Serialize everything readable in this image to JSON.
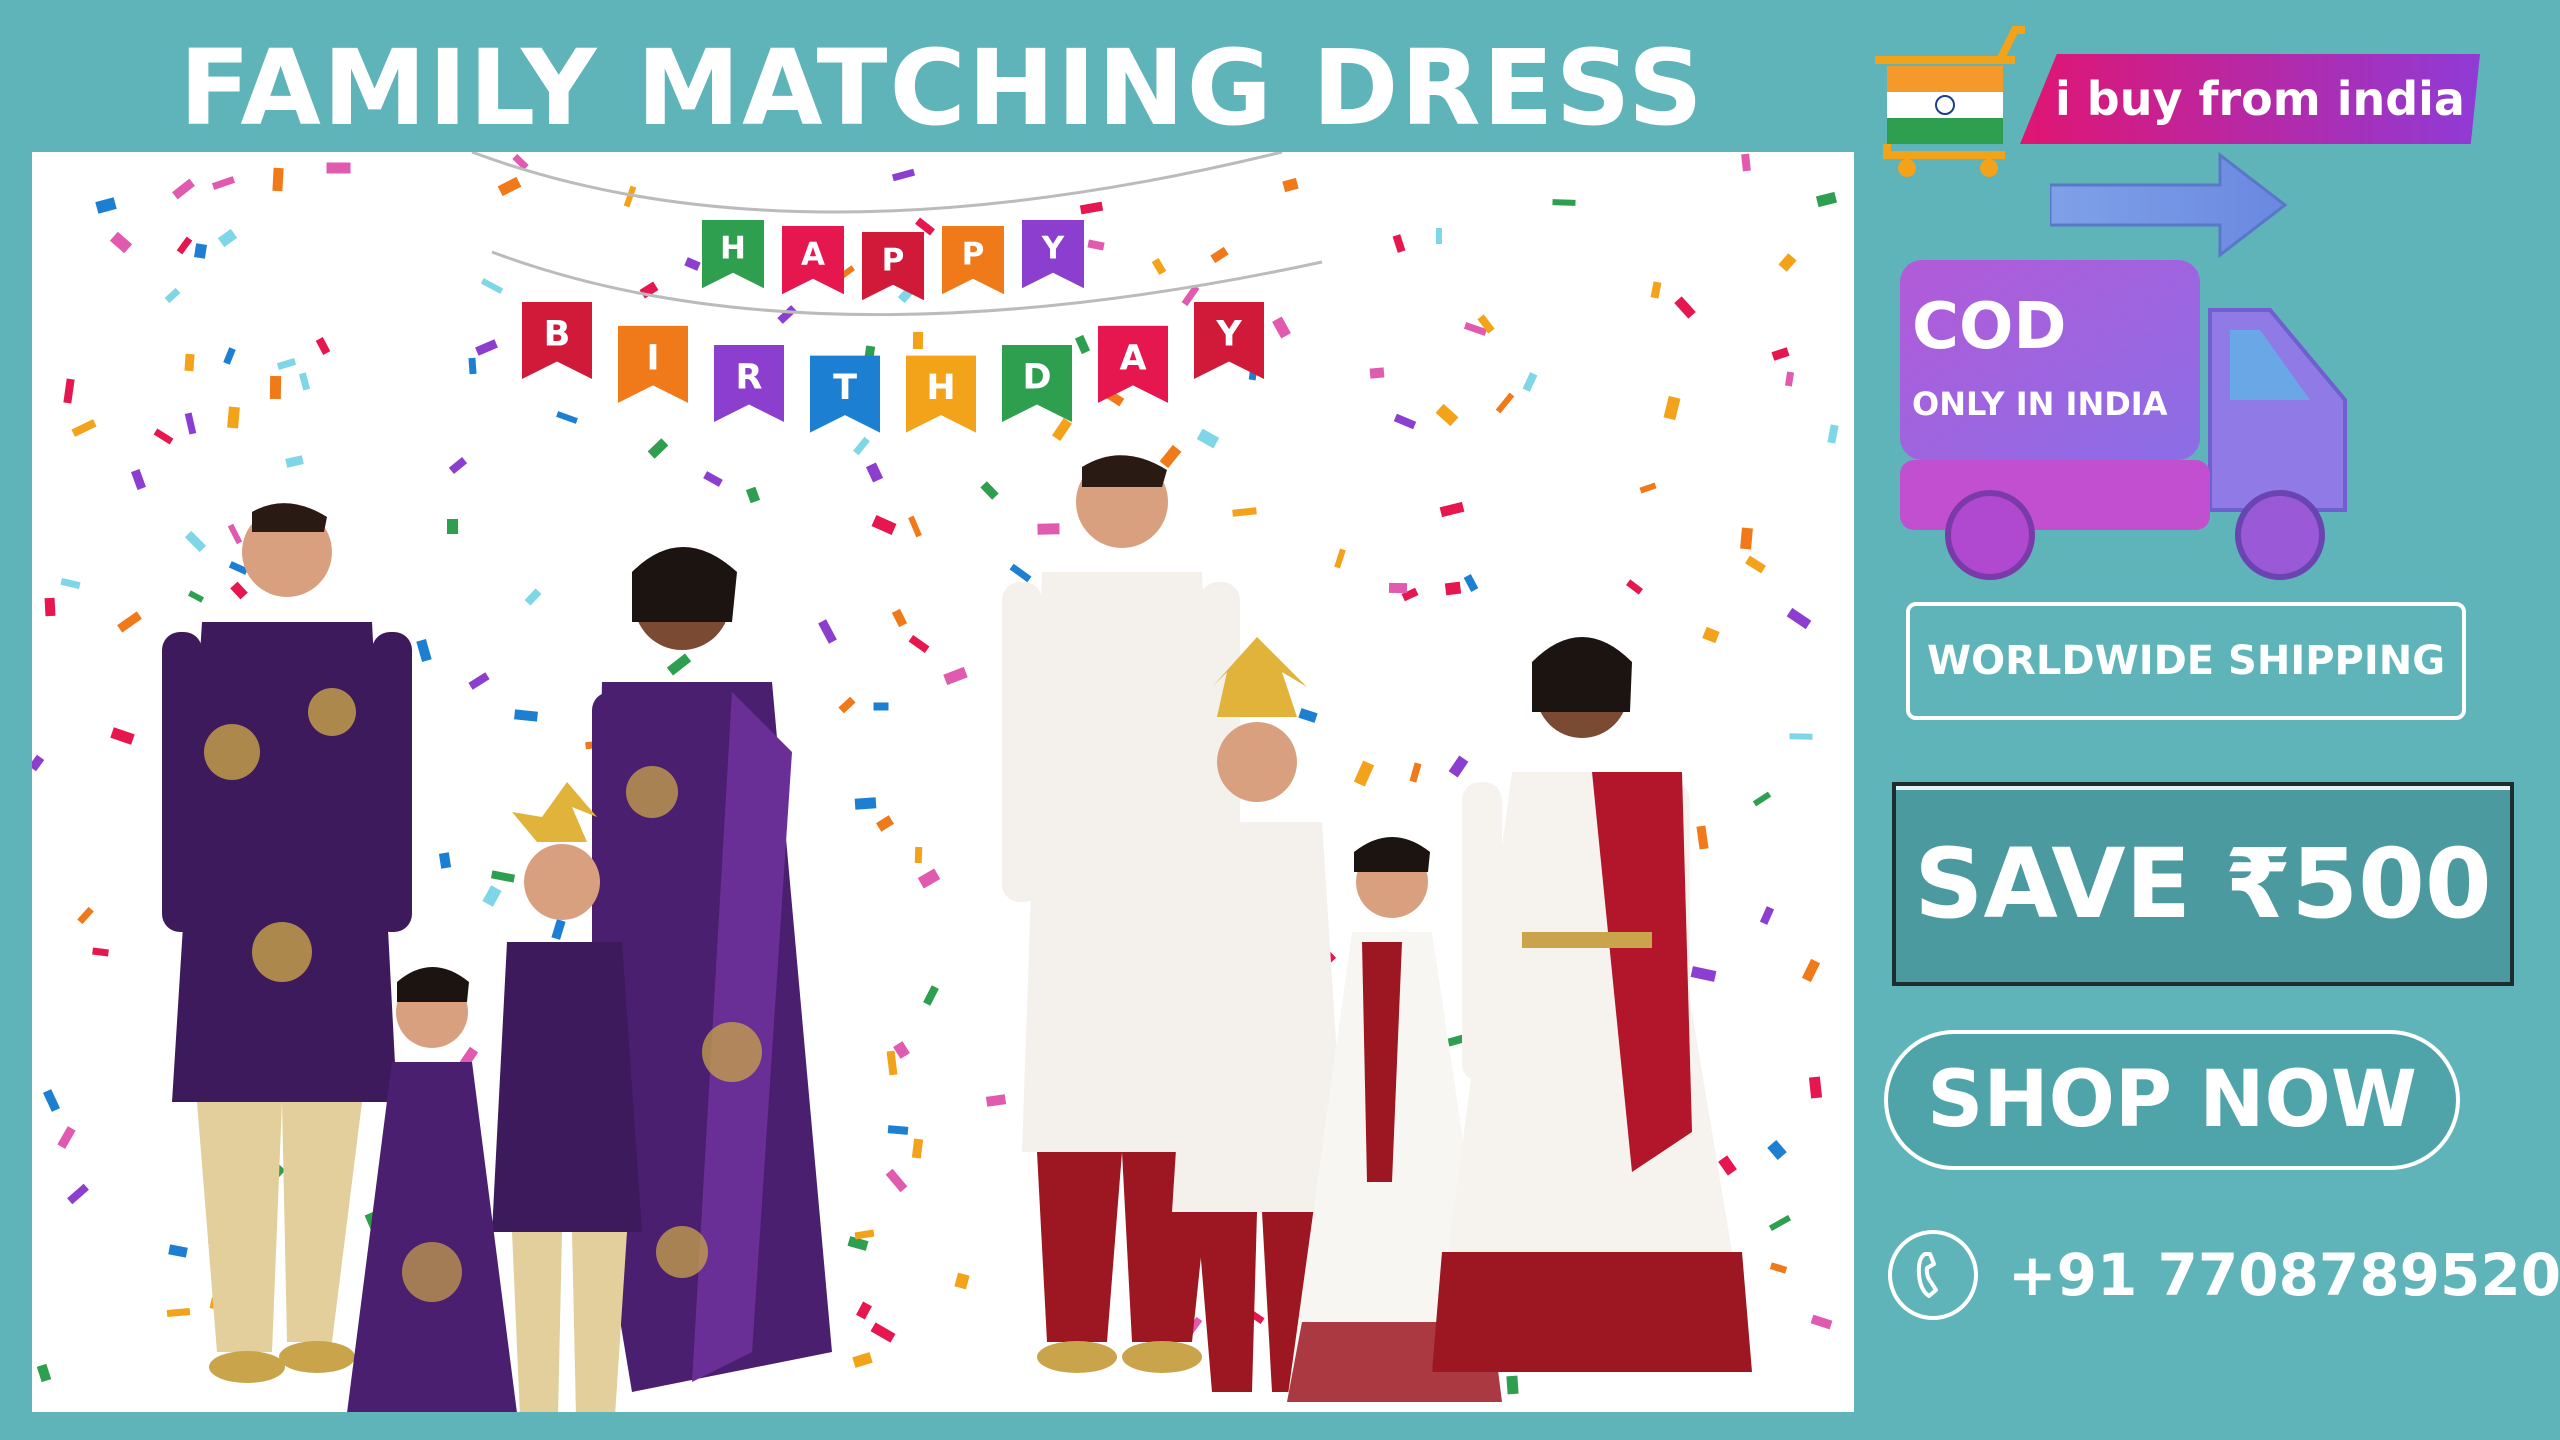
{
  "header": {
    "title": "FAMILY MATCHING DRESS"
  },
  "banner": {
    "row1": [
      "H",
      "A",
      "P",
      "P",
      "Y"
    ],
    "row2": [
      "B",
      "I",
      "R",
      "T",
      "H",
      "D",
      "A",
      "Y"
    ],
    "flag_colors": [
      "#2e9e4f",
      "#e6164e",
      "#d11a3a",
      "#f07a1a",
      "#8c3fcf",
      "#1d7fd1",
      "#f2a31a"
    ]
  },
  "brand": {
    "name": "i buy from india",
    "icon": "flag-cart-icon"
  },
  "cod": {
    "label": "COD",
    "sublabel": "ONLY IN INDIA",
    "icon": "truck-icon"
  },
  "shipping": {
    "label": "WORLDWIDE SHIPPING"
  },
  "offer": {
    "label": "SAVE ₹500"
  },
  "cta": {
    "label": "SHOP NOW"
  },
  "contact": {
    "phone": "+91 7708789520",
    "icon": "phone-icon"
  },
  "colors": {
    "background": "#5fb4b9",
    "purple_outfit": "#3d1a5c",
    "white_outfit": "#f4f1ec",
    "maroon_outfit": "#9c1722",
    "gold": "#c9a44a",
    "accent_gradient_start": "#e01572",
    "accent_gradient_end": "#8f3bd6"
  }
}
